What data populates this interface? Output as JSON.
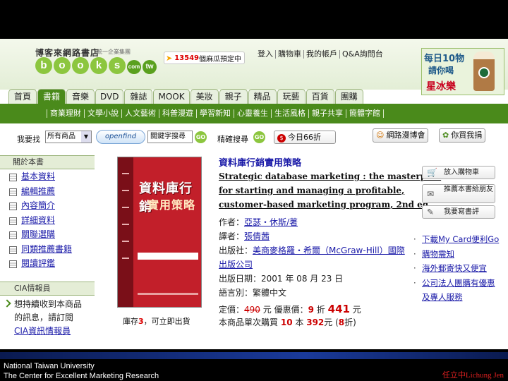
{
  "header": {
    "site_name_cn": "博客來網路書店",
    "site_group": "統一企業集團",
    "logo_letters": [
      "b",
      "o",
      "o",
      "k",
      "s",
      "com",
      "tw"
    ],
    "promo": {
      "number": "13549",
      "text": "個麻瓜預定中"
    },
    "top_links": [
      "登入",
      "購物車",
      "我的帳戶",
      "Q&A詢問台"
    ],
    "ad": {
      "line1": "每日10物",
      "line2": "請你喝",
      "line3": "星冰樂"
    }
  },
  "tabs": [
    "首頁",
    "書籍",
    "音樂",
    "DVD",
    "雜誌",
    "MOOK",
    "美妝",
    "親子",
    "精品",
    "玩藝",
    "百貨",
    "團購"
  ],
  "active_tab": "書籍",
  "categories": [
    "商業理財",
    "文學小說",
    "人文藝術",
    "科普漫遊",
    "學習新知",
    "心靈養生",
    "生活風格",
    "親子共享",
    "簡體字館"
  ],
  "search": {
    "label": "我要找",
    "scope": "所有商品",
    "openfind": "openfind",
    "keyword_label": "關鍵字搜尋",
    "go": "GO",
    "exact_label": "精確搜尋",
    "discount_label": "今日66折",
    "comic_expo": "網路漫博會",
    "you_buy": "你買我捐"
  },
  "left_menu": {
    "title": "關於本書",
    "items": [
      "基本資料",
      "編輯推薦",
      "內容簡介",
      "詳細資料",
      "關聯選購",
      "同類推薦書籍",
      "閱讀評鑑"
    ]
  },
  "cia": {
    "title": "CIA情報員",
    "line1": "想持續收到本商品",
    "line2": "的訊息，請訂閱",
    "link": "CIA資訊情報員"
  },
  "book": {
    "cover_title1": "資料庫行銷",
    "cover_title2": "實用策略",
    "stock_pre": "庫存",
    "stock_num": "3",
    "stock_post": "，可立即出貨",
    "title": "資料庫行銷實用策略",
    "subtitle_lines": [
      "Strategic database marketing : the masterplan",
      "for starting and managing a profitable,",
      "customer-based marketing program, 2nd ed."
    ],
    "author_label": "作者：",
    "author": "亞瑟・休斯/著",
    "translator_label": "譯者：",
    "translator": "張倩茜",
    "publisher_label": "出版社：",
    "publisher1": "美商麥格羅・希爾（McGraw-Hill）國際",
    "publisher2": "出版公司",
    "pubdate_label": "出版日期：",
    "pubdate": "2001 年 08 月 23 日",
    "language_label": "語言別：",
    "language": "繁體中文"
  },
  "price": {
    "list_label": "定價：",
    "list_price": "490",
    "unit": "元",
    "discount_label": "優惠價：",
    "discount": "9",
    "discount_unit": "折",
    "final": "441",
    "bulk_label": "本商品單次購買",
    "bulk_qty": "10",
    "bulk_unit": "本",
    "bulk_price": "392",
    "bulk_disc": "8",
    "bulk_disc_unit": "折"
  },
  "actions": {
    "cart": "放入購物車",
    "recommend": "推薦本書給朋友",
    "review": "我要寫書評"
  },
  "side_links": [
    "下載My Card便利Go",
    "購物需知",
    "海外郵寄快又便宜",
    "公司法人團購有優惠及專人服務"
  ],
  "footer": {
    "line1": "National Taiwan University",
    "line2": "The Center for Excellent Marketing Research",
    "right": "任立中Lichung Jen"
  }
}
